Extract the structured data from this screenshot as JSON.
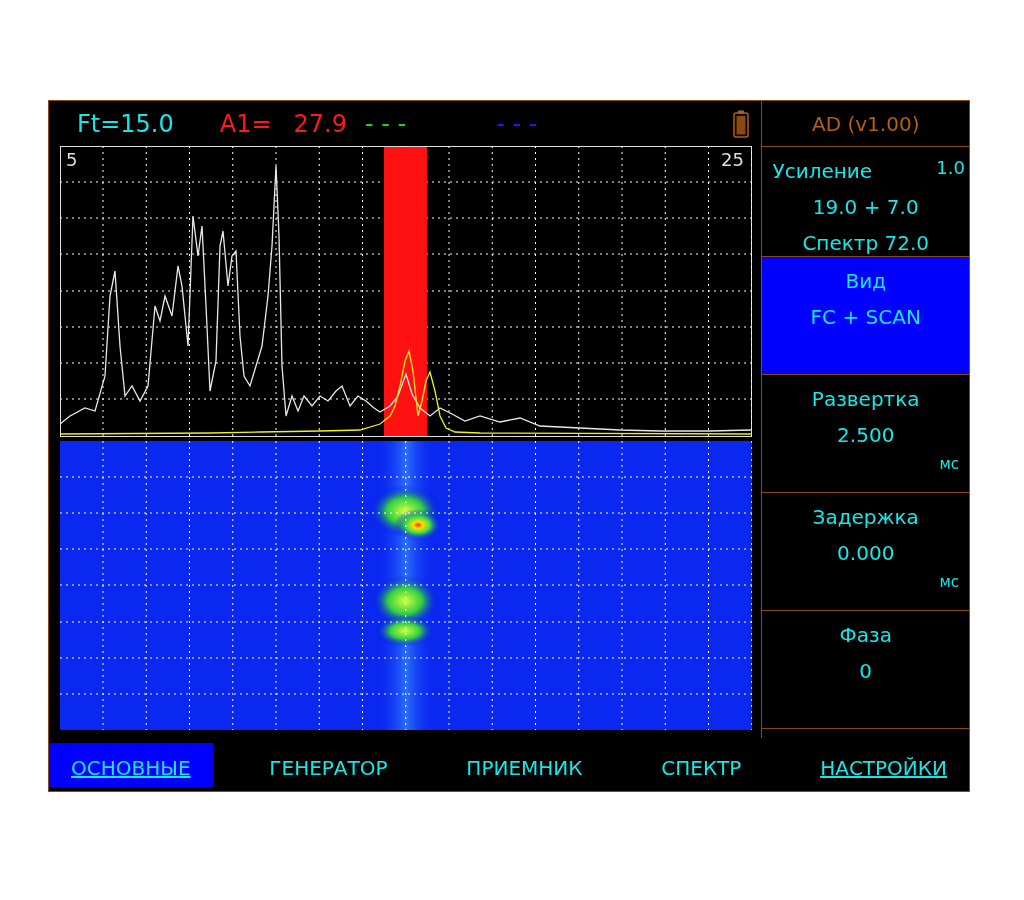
{
  "status_bar": {
    "readouts": [
      {
        "text": "Ft=15.0",
        "color": "#19e6e6"
      },
      {
        "text": "A1=",
        "color": "#ff1a1a"
      },
      {
        "text": "27.9",
        "color": "#ff1a1a"
      },
      {
        "text": "- - -",
        "color": "#19d619"
      },
      {
        "text": "- - -",
        "color": "#1a1aff"
      }
    ]
  },
  "a_scan": {
    "range_start": "5",
    "range_end": "25"
  },
  "sidebar": {
    "title": "AD (v1.00)",
    "params": [
      {
        "label": "Усиление",
        "step": "1.0",
        "lines": [
          "19.0 + 7.0",
          "Спектр 72.0"
        ],
        "selected": false
      },
      {
        "label": "Вид",
        "lines": [
          "FC + SCAN"
        ],
        "selected": true
      },
      {
        "label": "Развертка",
        "lines": [
          "2.500"
        ],
        "unit": "мс",
        "selected": false
      },
      {
        "label": "Задержка",
        "lines": [
          "0.000"
        ],
        "unit": "мс",
        "selected": false
      },
      {
        "label": "Фаза",
        "lines": [
          "0"
        ],
        "selected": false
      }
    ]
  },
  "tabs": [
    {
      "label": "ОСНОВНЫЕ",
      "selected": true,
      "underlined": true
    },
    {
      "label": "ГЕНЕРАТОР",
      "selected": false,
      "underlined": false
    },
    {
      "label": "ПРИЕМНИК",
      "selected": false,
      "underlined": false
    },
    {
      "label": "СПЕКТР",
      "selected": false,
      "underlined": false
    },
    {
      "label": "НАСТРОЙКИ",
      "selected": false,
      "underlined": true
    }
  ]
}
